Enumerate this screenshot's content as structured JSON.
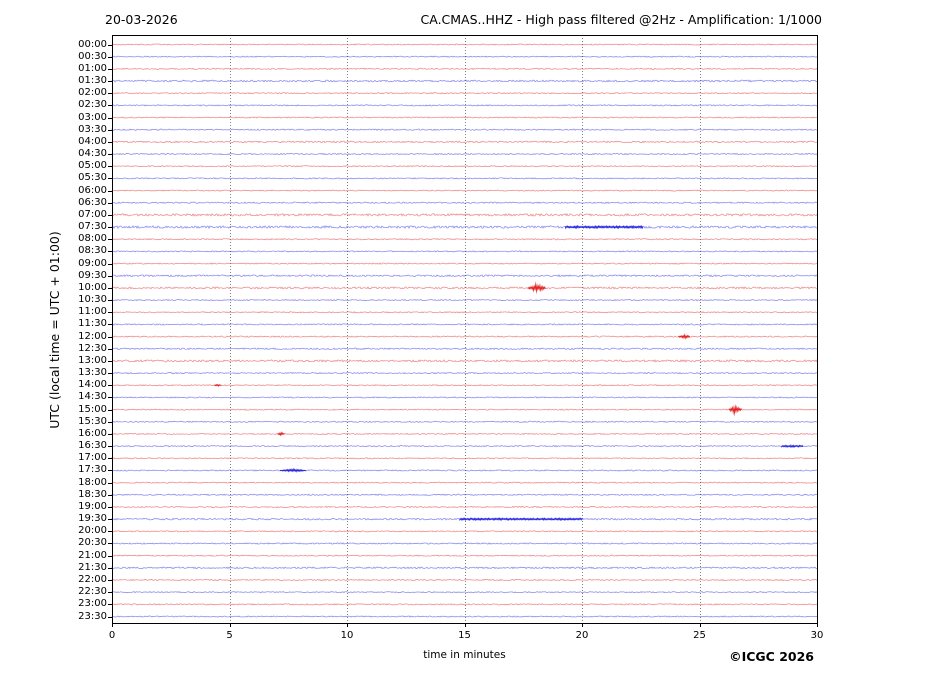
{
  "header": {
    "date_label": "20-03-2026",
    "station_title": "CA.CMAS..HHZ - High pass filtered @2Hz - Amplification: 1/1000"
  },
  "footer": {
    "copyright": "©ICGC 2026"
  },
  "chart_data": {
    "type": "line",
    "variant": "seismogram-helicorder-dayplot",
    "title": "CA.CMAS..HHZ - High pass filtered @2Hz - Amplification: 1/1000",
    "date": "20-03-2026",
    "xlabel": "time in minutes",
    "ylabel": "UTC (local time = UTC + 01:00)",
    "x_range": [
      0,
      30
    ],
    "x_ticks": [
      0,
      5,
      10,
      15,
      20,
      25,
      30
    ],
    "grid_minutes": [
      5,
      10,
      15,
      20,
      25
    ],
    "grid_style": "vertical dotted gray",
    "trace_colors": {
      "red": "#e02020",
      "blue": "#2020dd"
    },
    "rows": [
      {
        "label": "00:00",
        "color": "red",
        "noise": 0.55
      },
      {
        "label": "00:30",
        "color": "blue",
        "noise": 0.55
      },
      {
        "label": "01:00",
        "color": "red",
        "noise": 0.6
      },
      {
        "label": "01:30",
        "color": "blue",
        "noise": 0.85
      },
      {
        "label": "02:00",
        "color": "red",
        "noise": 0.55
      },
      {
        "label": "02:30",
        "color": "blue",
        "noise": 0.6
      },
      {
        "label": "03:00",
        "color": "red",
        "noise": 0.55
      },
      {
        "label": "03:30",
        "color": "blue",
        "noise": 0.6
      },
      {
        "label": "04:00",
        "color": "red",
        "noise": 0.75
      },
      {
        "label": "04:30",
        "color": "blue",
        "noise": 0.6
      },
      {
        "label": "05:00",
        "color": "red",
        "noise": 0.55
      },
      {
        "label": "05:30",
        "color": "blue",
        "noise": 0.55
      },
      {
        "label": "06:00",
        "color": "red",
        "noise": 0.55
      },
      {
        "label": "06:30",
        "color": "blue",
        "noise": 0.65
      },
      {
        "label": "07:00",
        "color": "red",
        "noise": 1.1
      },
      {
        "label": "07:30",
        "color": "blue",
        "noise": 1.15
      },
      {
        "label": "08:00",
        "color": "red",
        "noise": 0.6
      },
      {
        "label": "08:30",
        "color": "blue",
        "noise": 0.55
      },
      {
        "label": "09:00",
        "color": "red",
        "noise": 0.55
      },
      {
        "label": "09:30",
        "color": "blue",
        "noise": 0.85
      },
      {
        "label": "10:00",
        "color": "red",
        "noise": 0.9
      },
      {
        "label": "10:30",
        "color": "blue",
        "noise": 0.6
      },
      {
        "label": "11:00",
        "color": "red",
        "noise": 0.55
      },
      {
        "label": "11:30",
        "color": "blue",
        "noise": 0.6
      },
      {
        "label": "12:00",
        "color": "red",
        "noise": 0.6
      },
      {
        "label": "12:30",
        "color": "blue",
        "noise": 0.7
      },
      {
        "label": "13:00",
        "color": "red",
        "noise": 1.0
      },
      {
        "label": "13:30",
        "color": "blue",
        "noise": 0.6
      },
      {
        "label": "14:00",
        "color": "red",
        "noise": 0.55
      },
      {
        "label": "14:30",
        "color": "blue",
        "noise": 0.55
      },
      {
        "label": "15:00",
        "color": "red",
        "noise": 0.55
      },
      {
        "label": "15:30",
        "color": "blue",
        "noise": 0.6
      },
      {
        "label": "16:00",
        "color": "red",
        "noise": 0.55
      },
      {
        "label": "16:30",
        "color": "blue",
        "noise": 0.6
      },
      {
        "label": "17:00",
        "color": "red",
        "noise": 0.55
      },
      {
        "label": "17:30",
        "color": "blue",
        "noise": 0.6
      },
      {
        "label": "18:00",
        "color": "red",
        "noise": 0.55
      },
      {
        "label": "18:30",
        "color": "blue",
        "noise": 0.6
      },
      {
        "label": "19:00",
        "color": "red",
        "noise": 0.6
      },
      {
        "label": "19:30",
        "color": "blue",
        "noise": 0.8
      },
      {
        "label": "20:00",
        "color": "red",
        "noise": 0.55
      },
      {
        "label": "20:30",
        "color": "blue",
        "noise": 0.6
      },
      {
        "label": "21:00",
        "color": "red",
        "noise": 0.55
      },
      {
        "label": "21:30",
        "color": "blue",
        "noise": 0.75
      },
      {
        "label": "22:00",
        "color": "red",
        "noise": 0.6
      },
      {
        "label": "22:30",
        "color": "blue",
        "noise": 0.55
      },
      {
        "label": "23:00",
        "color": "red",
        "noise": 0.6
      },
      {
        "label": "23:30",
        "color": "blue",
        "noise": 0.55
      }
    ],
    "events": [
      {
        "row": "07:30",
        "start_min": 19.3,
        "end_min": 22.6,
        "amplitude": 1.0,
        "kind": "noise-burst"
      },
      {
        "row": "10:00",
        "start_min": 17.7,
        "end_min": 18.45,
        "amplitude": 4.0,
        "kind": "spike"
      },
      {
        "row": "12:00",
        "start_min": 24.1,
        "end_min": 24.6,
        "amplitude": 2.0,
        "kind": "spike"
      },
      {
        "row": "14:00",
        "start_min": 4.35,
        "end_min": 4.65,
        "amplitude": 0.9,
        "kind": "spike"
      },
      {
        "row": "15:00",
        "start_min": 26.25,
        "end_min": 26.8,
        "amplitude": 4.0,
        "kind": "spike"
      },
      {
        "row": "16:00",
        "start_min": 7.05,
        "end_min": 7.35,
        "amplitude": 1.5,
        "kind": "spike"
      },
      {
        "row": "16:30",
        "start_min": 28.5,
        "end_min": 29.4,
        "amplitude": 1.0,
        "kind": "noise-burst"
      },
      {
        "row": "17:30",
        "start_min": 7.15,
        "end_min": 8.25,
        "amplitude": 1.5,
        "kind": "spike"
      },
      {
        "row": "19:30",
        "start_min": 14.8,
        "end_min": 20.0,
        "amplitude": 0.9,
        "kind": "noise-burst"
      }
    ],
    "legend_position": "none",
    "grid_on": true
  }
}
